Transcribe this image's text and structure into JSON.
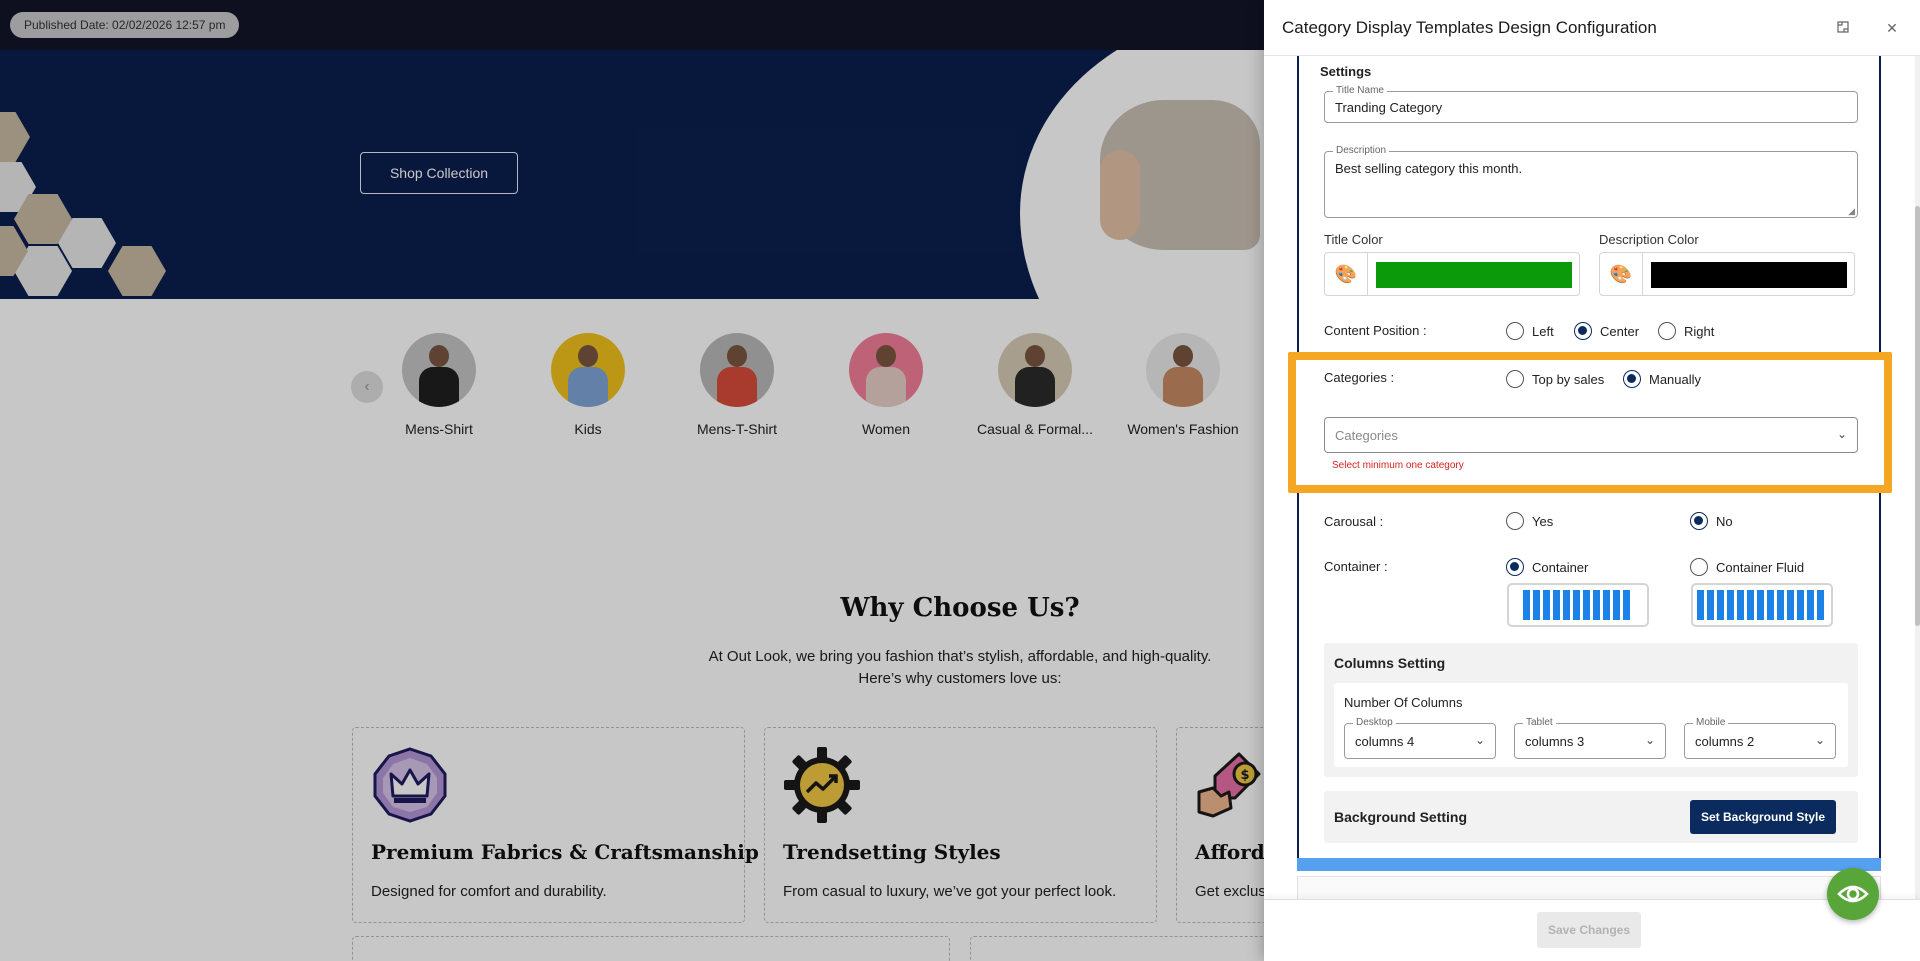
{
  "page": {
    "published_badge": "Published Date: 02/02/2026 12:57 pm",
    "hero": {
      "cta_label": "Shop Collection"
    },
    "categories": [
      {
        "label": "Mens-Shirt",
        "bg": "#c4c4c4",
        "shirt": "#1f1f1f"
      },
      {
        "label": "Kids",
        "bg": "#f1c21b",
        "shirt": "#7fa5d8"
      },
      {
        "label": "Mens-T-Shirt",
        "bg": "#b9b9b9",
        "shirt": "#d94b3b"
      },
      {
        "label": "Women",
        "bg": "#f27e99",
        "shirt": "#e7cfc8"
      },
      {
        "label": "Casual & Formal...",
        "bg": "#d8cbb5",
        "shirt": "#2b2b2b"
      },
      {
        "label": "Women's Fashion",
        "bg": "#eaeaea",
        "shirt": "#c68a62"
      }
    ],
    "why": {
      "title": "Why Choose Us?",
      "subtitle_line1": "At Out Look, we bring you fashion that’s stylish, affordable, and high-quality.",
      "subtitle_line2": "Here’s why customers love us:"
    },
    "features": [
      {
        "title": "Premium Fabrics & Craftsmanship",
        "desc": "Designed for comfort and durability.",
        "icon": "crown-badge-icon"
      },
      {
        "title": "Trendsetting Styles",
        "desc": "From casual to luxury, we’ve got your perfect look.",
        "icon": "gear-trend-icon"
      },
      {
        "title": "Afforda",
        "desc": "Get exclus",
        "icon": "price-tag-icon"
      }
    ]
  },
  "drawer": {
    "title": "Category Display Templates Design Configuration",
    "settings_label": "Settings",
    "title_name": {
      "legend": "Title Name",
      "value": "Tranding Category"
    },
    "description": {
      "legend": "Description",
      "value": "Best selling category this month."
    },
    "title_color": {
      "label": "Title Color",
      "value": "#0a9a0a"
    },
    "description_color": {
      "label": "Description Color",
      "value": "#000000"
    },
    "content_position": {
      "label": "Content Position :",
      "options": [
        "Left",
        "Center",
        "Right"
      ],
      "selected": "Center"
    },
    "categories": {
      "label": "Categories :",
      "options": [
        "Top by sales",
        "Manually"
      ],
      "selected": "Manually",
      "select_placeholder": "Categories",
      "error": "Select minimum one category"
    },
    "carousal": {
      "label": "Carousal :",
      "options": [
        "Yes",
        "No"
      ],
      "selected": "No"
    },
    "container": {
      "label": "Container :",
      "options": [
        "Container",
        "Container Fluid"
      ],
      "selected": "Container"
    },
    "columns_setting": {
      "title": "Columns Setting",
      "subtitle": "Number Of Columns",
      "desktop": {
        "legend": "Desktop",
        "value": "columns 4"
      },
      "tablet": {
        "legend": "Tablet",
        "value": "columns 3"
      },
      "mobile": {
        "legend": "Mobile",
        "value": "columns 2"
      }
    },
    "background_setting": {
      "title": "Background Setting",
      "button_label": "Set Background Style"
    },
    "save_label": "Save Changes"
  },
  "colors": {
    "navy": "#0b1f4e",
    "highlight": "#f5a623",
    "primary_button": "#0b2a5e",
    "fab": "#58a63a",
    "error": "#d6231f"
  }
}
